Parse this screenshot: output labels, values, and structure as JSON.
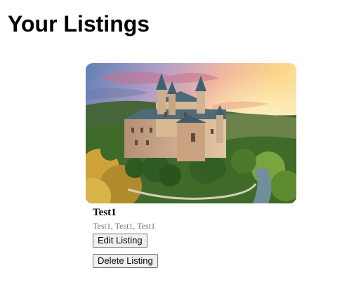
{
  "page": {
    "title": "Your Listings"
  },
  "listings": [
    {
      "image": "castle-photo",
      "title": "Test1",
      "meta": "Test1, Test1, Test1",
      "edit_label": "Edit Listing",
      "delete_label": "Delete Listing"
    }
  ]
}
